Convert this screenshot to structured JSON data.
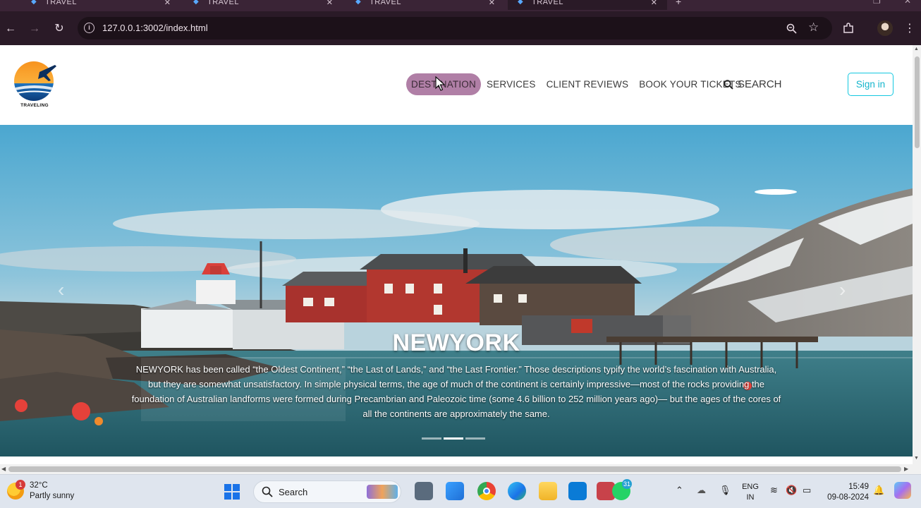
{
  "browser": {
    "tabs": [
      {
        "title": "TRAVEL",
        "active": false
      },
      {
        "title": "TRAVEL",
        "active": false
      },
      {
        "title": "TRAVEL",
        "active": false
      },
      {
        "title": "TRAVEL",
        "active": true
      }
    ],
    "url": "127.0.0.1:3002/index.html"
  },
  "site": {
    "logo_text": "TRAVELING",
    "nav": [
      {
        "label": "DESTINATION",
        "active": true
      },
      {
        "label": "SERVICES",
        "active": false
      },
      {
        "label": "CLIENT REVIEWS",
        "active": false
      },
      {
        "label": "BOOK YOUR TICKETS",
        "active": false
      }
    ],
    "search_label": "SEARCH",
    "signin_label": "Sign in"
  },
  "carousel": {
    "title": "NEWYORK",
    "text": "NEWYORK has been called “the Oldest Continent,” “the Last of Lands,” and “the Last Frontier.” Those descriptions typify the world’s fascination with Australia, but they are somewhat unsatisfactory. In simple physical terms, the age of much of the continent is certainly impressive—most of the rocks providing the foundation of Australian landforms were formed during Precambrian and Paleozoic time (some 4.6 billion to 252 million years ago)— but the ages of the cores of all the continents are approximately the same.",
    "slides": 3,
    "active_slide": 2
  },
  "taskbar": {
    "weather_temp": "32°C",
    "weather_desc": "Partly sunny",
    "weather_badge": "1",
    "search_label": "Search",
    "whatsapp_badge": "31",
    "lang_line1": "ENG",
    "lang_line2": "IN",
    "time": "15:49",
    "date": "09-08-2024"
  }
}
